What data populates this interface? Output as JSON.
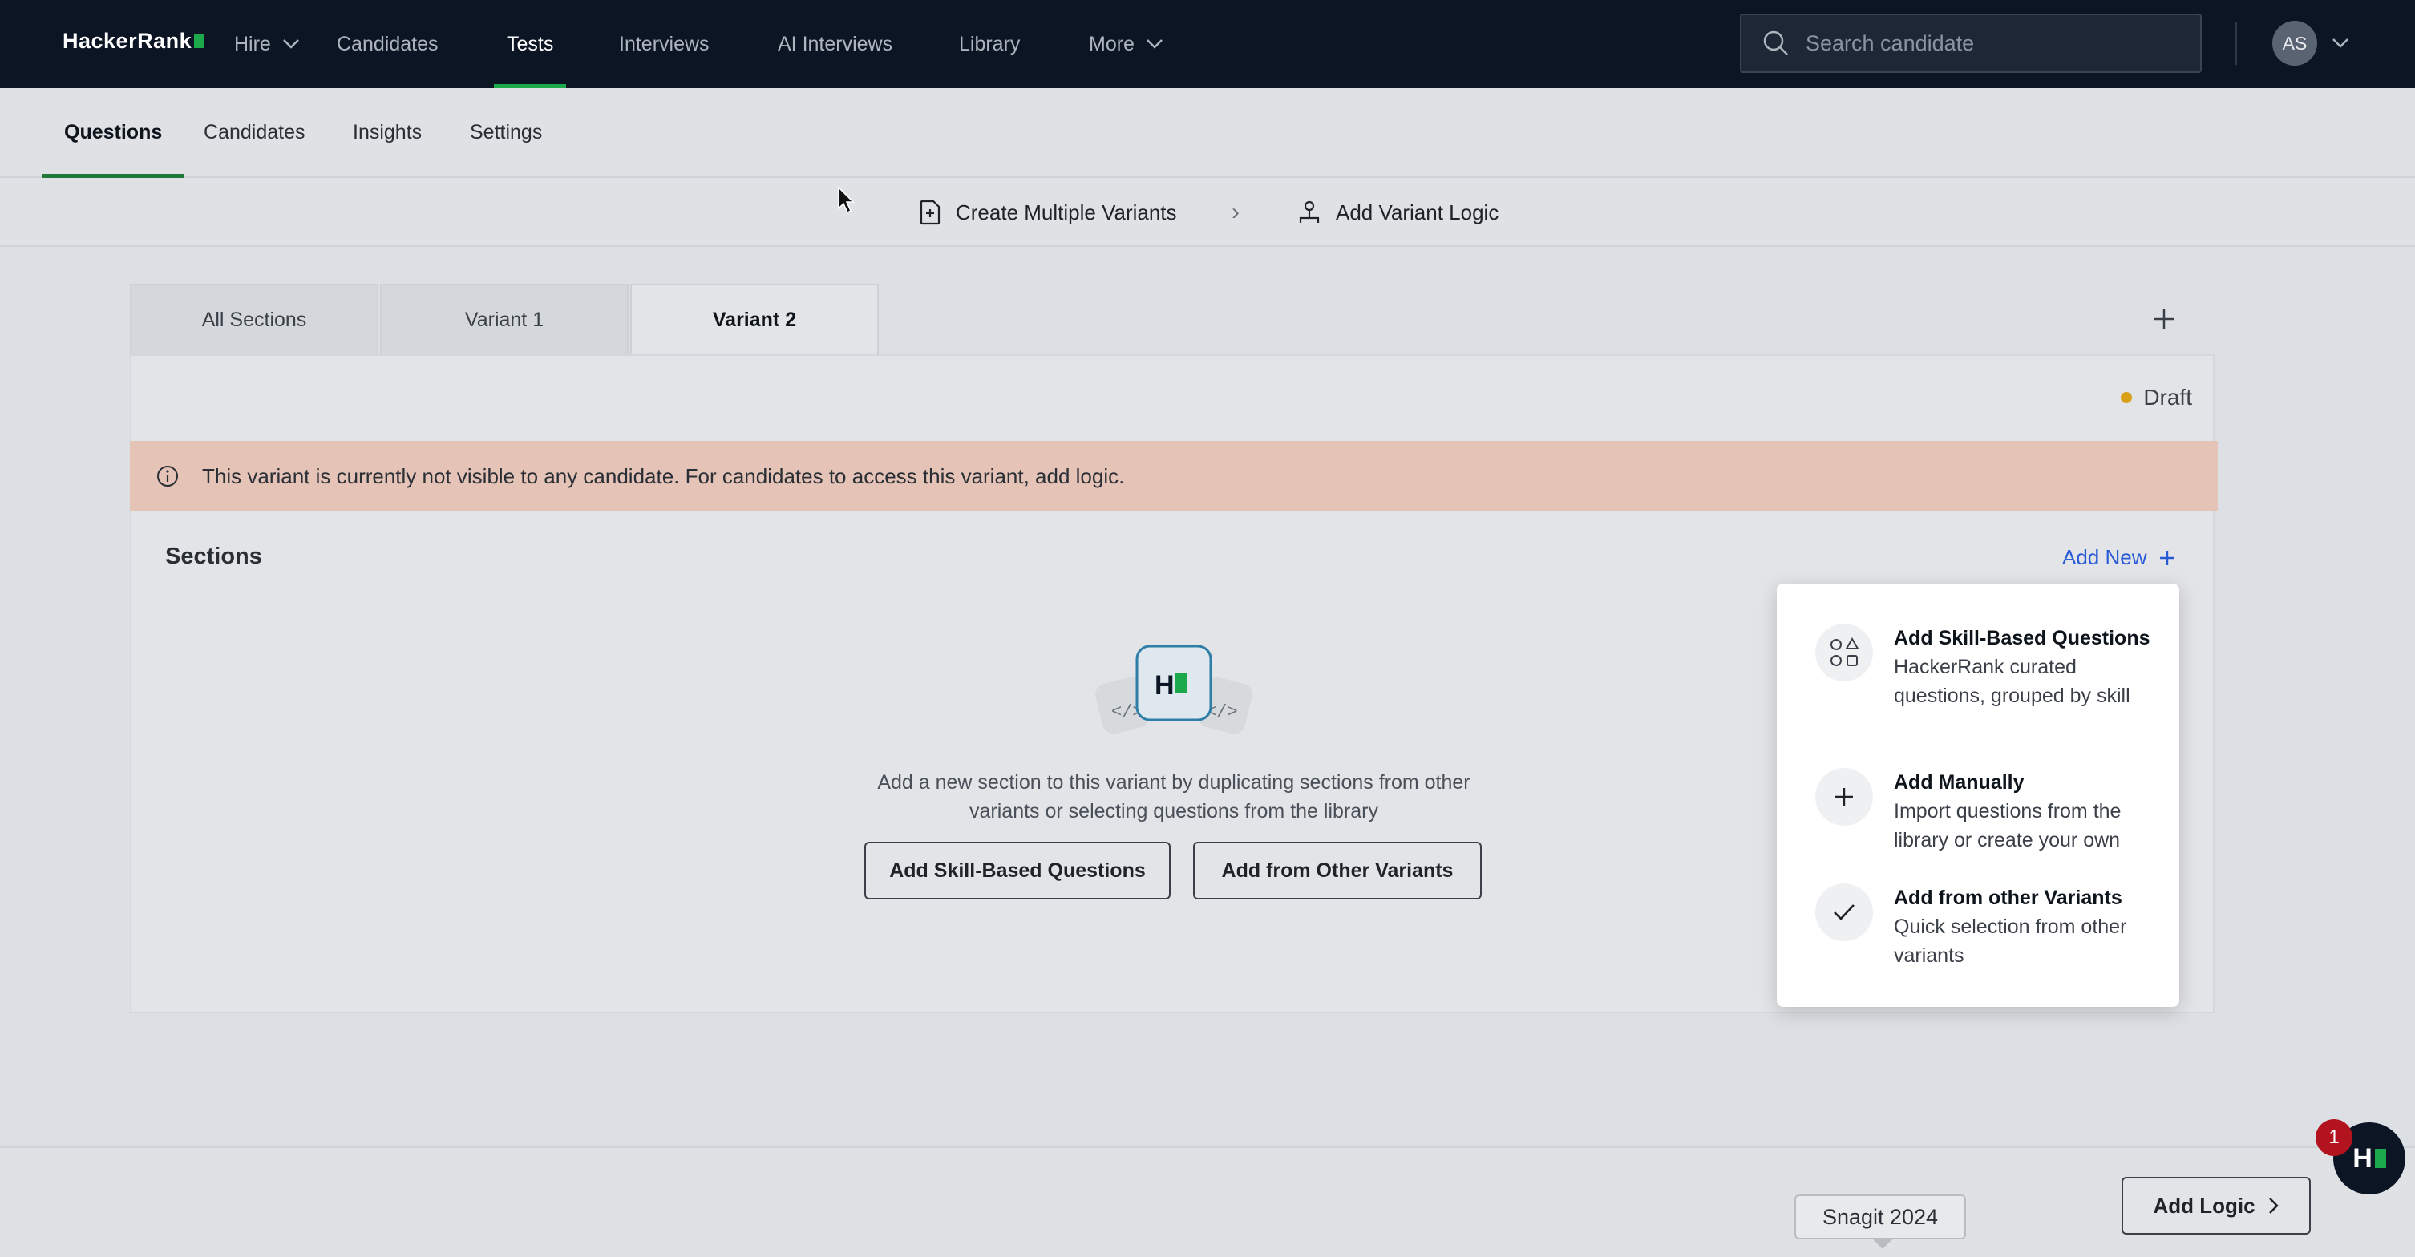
{
  "topnav": {
    "logo": "HackerRank",
    "items": [
      {
        "label": "Hire",
        "has_dropdown": true
      },
      {
        "label": "Candidates"
      },
      {
        "label": "Tests",
        "active": true
      },
      {
        "label": "Interviews"
      },
      {
        "label": "AI Interviews"
      },
      {
        "label": "Library"
      },
      {
        "label": "More",
        "has_dropdown": true
      }
    ],
    "search_placeholder": "Search candidate",
    "avatar_initials": "AS"
  },
  "subnav": {
    "tabs": [
      {
        "label": "Questions",
        "active": true
      },
      {
        "label": "Candidates"
      },
      {
        "label": "Insights"
      },
      {
        "label": "Settings"
      }
    ]
  },
  "variant_toolbar": {
    "create_label": "Create Multiple Variants",
    "separator": "›",
    "logic_label": "Add Variant Logic"
  },
  "variant_tabs": [
    {
      "label": "All Sections"
    },
    {
      "label": "Variant 1"
    },
    {
      "label": "Variant 2",
      "active": true
    }
  ],
  "card": {
    "status": "Draft",
    "banner": "This variant is currently not visible to any candidate. For candidates to access this variant, add logic.",
    "sections_title": "Sections",
    "add_new": "Add New",
    "empty_text": "Add a new section to this variant by duplicating sections from other variants or selecting questions from the library",
    "btn_skill": "Add Skill-Based Questions",
    "btn_other": "Add from Other Variants"
  },
  "menu": {
    "items": [
      {
        "title": "Add Skill-Based Questions",
        "desc": "HackerRank curated questions, grouped by skill",
        "icon": "shapes-icon"
      },
      {
        "title": "Add Manually",
        "desc": "Import questions from the library or create your own",
        "icon": "plus-icon"
      },
      {
        "title": "Add from other Variants",
        "desc": "Quick selection from other variants",
        "icon": "check-icon"
      }
    ]
  },
  "footer": {
    "snagit": "Snagit 2024",
    "add_logic": "Add Logic",
    "badge_count": "1"
  },
  "colors": {
    "nav_bg": "#0b1524",
    "brand_green": "#1ba94c",
    "link_blue": "#2a5bd7",
    "banner_bg": "#e5c3b6",
    "draft_dot": "#d9a11a",
    "badge_red": "#b3121f"
  }
}
